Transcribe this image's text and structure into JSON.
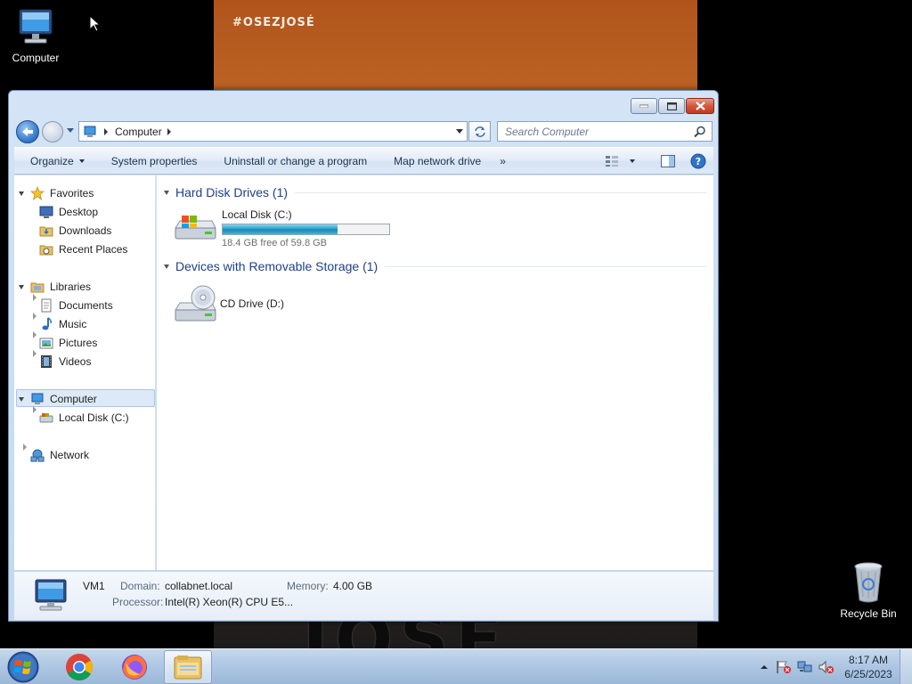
{
  "wallpaper": {
    "tag_text": "#OSEZJOSÉ",
    "bottom_text": "JOSÉ"
  },
  "desktop": {
    "icons": [
      {
        "label": "Computer",
        "icon": "computer-icon"
      },
      {
        "label": "Recycle Bin",
        "icon": "recycle-bin-icon"
      }
    ]
  },
  "window": {
    "address": {
      "segments": [
        "Computer"
      ]
    },
    "search": {
      "placeholder": "Search Computer"
    },
    "toolbar": {
      "organize": "Organize",
      "system_properties": "System properties",
      "uninstall": "Uninstall or change a program",
      "map_drive": "Map network drive",
      "more": "»"
    },
    "nav": {
      "favorites": {
        "label": "Favorites",
        "items": [
          "Desktop",
          "Downloads",
          "Recent Places"
        ]
      },
      "libraries": {
        "label": "Libraries",
        "items": [
          "Documents",
          "Music",
          "Pictures",
          "Videos"
        ]
      },
      "computer": {
        "label": "Computer",
        "items": [
          "Local Disk (C:)"
        ]
      },
      "network": {
        "label": "Network"
      }
    },
    "groups": {
      "hdd": {
        "title": "Hard Disk Drives (1)",
        "drive": {
          "name": "Local Disk (C:)",
          "free_text": "18.4 GB free of 59.8 GB",
          "used_fraction": 0.692
        }
      },
      "removable": {
        "title": "Devices with Removable Storage (1)",
        "drive": {
          "name": "CD Drive (D:)"
        }
      }
    },
    "details": {
      "name": "VM1",
      "domain_label": "Domain:",
      "domain_value": "collabnet.local",
      "memory_label": "Memory:",
      "memory_value": "4.00 GB",
      "processor_label": "Processor:",
      "processor_value": "Intel(R) Xeon(R) CPU E5..."
    }
  },
  "taskbar": {
    "time": "8:17 AM",
    "date": "6/25/2023",
    "pinned": [
      "chrome-icon",
      "firefox-icon",
      "explorer-icon"
    ]
  },
  "colors": {
    "taskbar": "#adc6e2",
    "accent_link": "#1e3f8a",
    "progress": "#27a1cb"
  }
}
